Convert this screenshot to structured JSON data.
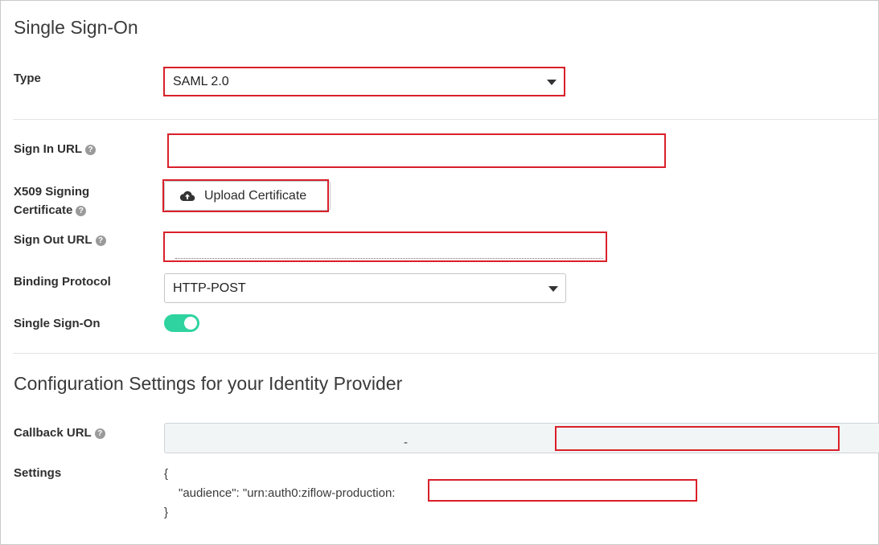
{
  "sso": {
    "title": "Single Sign-On",
    "type_label": "Type",
    "type_value": "SAML 2.0",
    "sign_in_url_label": "Sign In URL",
    "sign_in_url_value": "",
    "x509_label_line1": "X509 Signing",
    "x509_label_line2": "Certificate",
    "upload_button": "Upload Certificate",
    "sign_out_url_label": "Sign Out URL",
    "sign_out_url_value": "",
    "binding_label": "Binding Protocol",
    "binding_value": "HTTP-POST",
    "sso_toggle_label": "Single Sign-On",
    "sso_toggle_on": true
  },
  "idp": {
    "title": "Configuration Settings for your Identity Provider",
    "callback_label": "Callback URL",
    "callback_value": "-",
    "settings_label": "Settings",
    "settings_open": "{",
    "settings_line": "\"audience\": \"urn:auth0:ziflow-production:",
    "settings_close": "}"
  },
  "colors": {
    "highlight": "#d9202a",
    "toggle_on": "#2fd3a0"
  }
}
